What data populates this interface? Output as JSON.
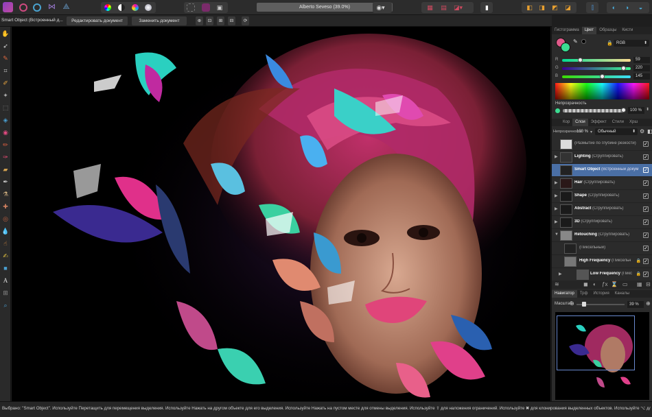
{
  "document": {
    "title": "Alberto Seveso (39.0%)"
  },
  "context_bar": {
    "selection_label": "Smart Object (Встроенный д...",
    "edit_button": "Редактировать документ",
    "replace_button": "Заменить документ"
  },
  "colors": {
    "accent": "#4a6fa5",
    "bg": "#1e1e1e",
    "panel": "#2b2b2b"
  },
  "panel_tabs_top": [
    "Гистограмма",
    "Цвет",
    "Образцы",
    "Кисти"
  ],
  "color_panel": {
    "mode": "RGB",
    "r_label": "R",
    "g_label": "G",
    "b_label": "B",
    "r": "59",
    "g": "220",
    "b": "145",
    "opacity_label": "Непрозрачность",
    "opacity_value": "100 %"
  },
  "panel_tabs_mid": [
    "Кор",
    "Слои",
    "Эффект",
    "Стили",
    "Хрш"
  ],
  "layers_panel": {
    "opacity_label": "Непрозрачность:",
    "opacity_value": "100 %",
    "blend_mode": "Обычный",
    "layers": [
      {
        "name": "",
        "detail": "(Размытие по глубине резкости)"
      },
      {
        "name": "Lighting",
        "detail": "(Сгруппировать)"
      },
      {
        "name": "Smart Object",
        "detail": "(Встроенный докум"
      },
      {
        "name": "Hair",
        "detail": "(Сгруппировать)"
      },
      {
        "name": "Shape",
        "detail": "(Сгруппировать)"
      },
      {
        "name": "Abstract",
        "detail": "(Сгруппировать)"
      },
      {
        "name": "3D",
        "detail": "(Сгруппировать)"
      },
      {
        "name": "Retouching",
        "detail": "(Сгруппировать)"
      },
      {
        "name": "",
        "detail": "(Пиксельный)"
      },
      {
        "name": "High Frequency",
        "detail": "(Пиксельн"
      },
      {
        "name": "Low Frequency",
        "detail": "(Пикс"
      }
    ]
  },
  "panel_tabs_bottom": [
    "Навигатор",
    "Трф",
    "История",
    "Каналы"
  ],
  "navigator": {
    "zoom_label": "Масштаб:",
    "zoom_value": "39 %"
  },
  "status": {
    "text": "Выбрано: \"Smart Object\". Используйте Перетащить для перемещения выделения. Используйте Нажать на другом объекте для его выделения. Используйте Нажать на пустом месте для отмены выделения. Используйте ⇧ для наложения ограничений. Используйте ✖ для клонирования выделенных объектов. Используйте ⌥ для"
  }
}
